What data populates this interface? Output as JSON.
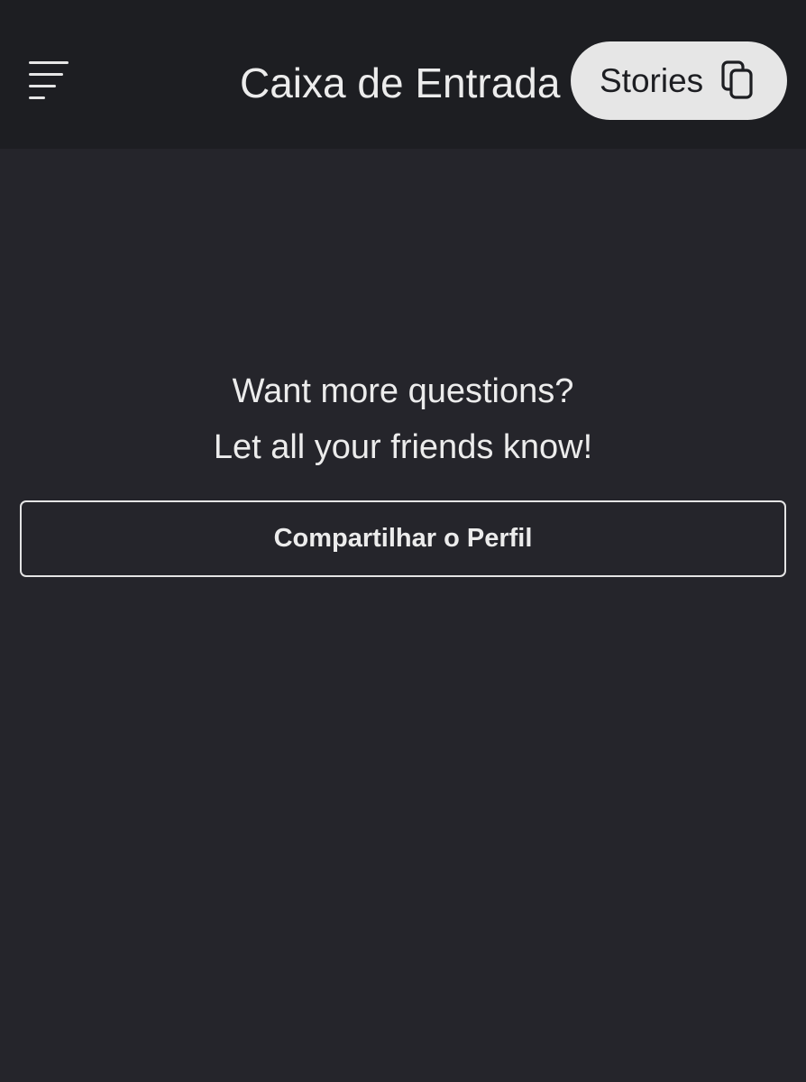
{
  "header": {
    "menu_icon": "menu-icon",
    "title": "Caixa de Entrada",
    "stories_button": {
      "label": "Stories",
      "icon": "copy-icon"
    }
  },
  "empty_state": {
    "line1": "Want more questions?",
    "line2": "Let all your friends know!"
  },
  "share_button": {
    "label": "Compartilhar o Perfil"
  },
  "colors": {
    "header_bg": "#1d1e22",
    "page_bg": "#25252b",
    "text": "#ececec",
    "pill_bg": "#e6e6e6"
  }
}
